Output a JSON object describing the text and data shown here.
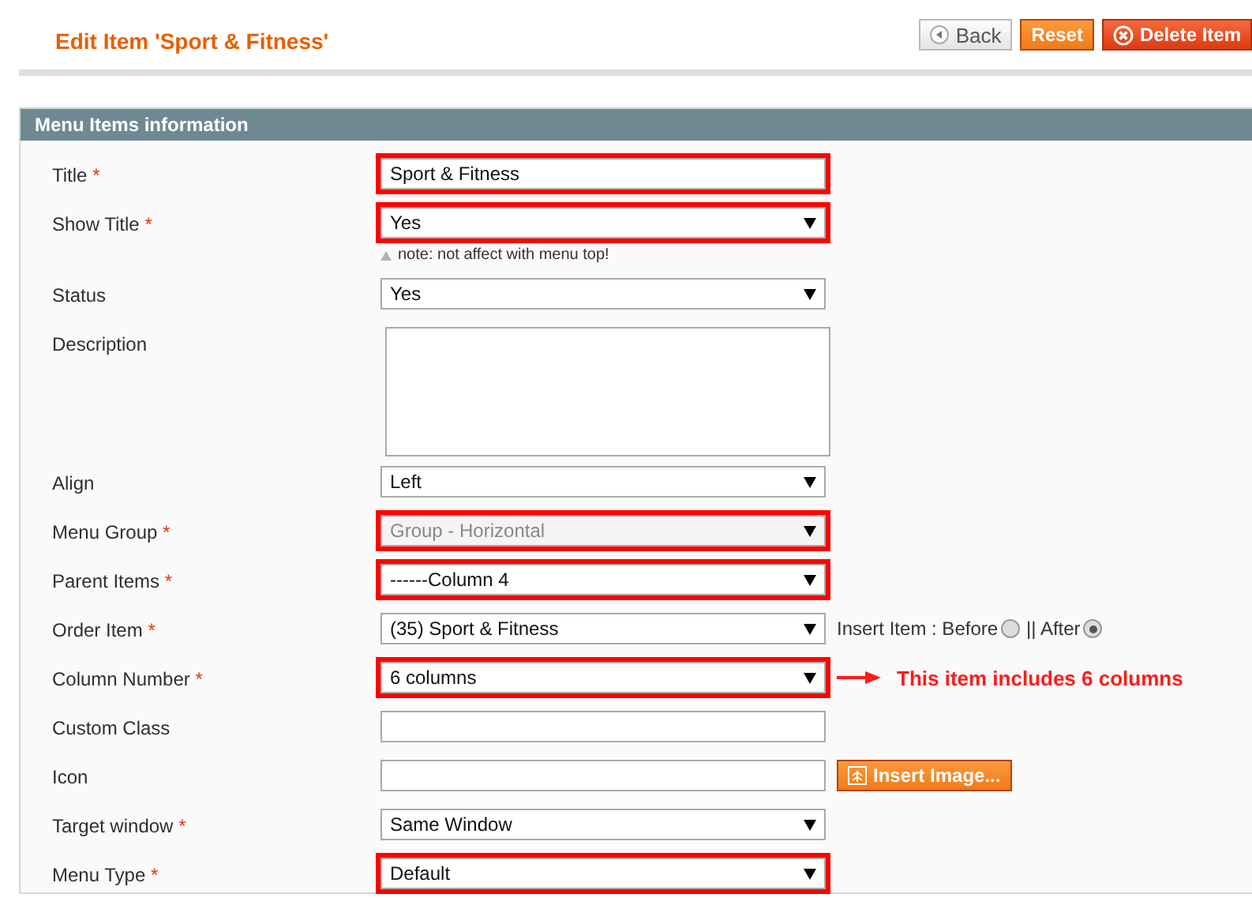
{
  "header": {
    "title": "Edit Item 'Sport & Fitness'",
    "buttons": [
      {
        "label": "Back",
        "kind": "back"
      },
      {
        "label": "Reset",
        "kind": "reset"
      },
      {
        "label": "Delete Item",
        "kind": "delete"
      }
    ]
  },
  "section": {
    "title": "Menu Items information"
  },
  "fields": [
    {
      "label": "Title",
      "required_mark": "*",
      "kind": "text",
      "value": "Sport & Fitness",
      "highlighted": true
    },
    {
      "label": "Show Title",
      "required_mark": "*",
      "kind": "select",
      "value": "Yes",
      "highlighted": true,
      "disabled": false,
      "note": "note: not affect with menu top!"
    },
    {
      "label": "Status",
      "kind": "select",
      "value": "Yes",
      "highlighted": false,
      "disabled": false
    },
    {
      "label": "Description",
      "kind": "textarea",
      "highlighted": false
    },
    {
      "label": "Align",
      "kind": "select",
      "value": "Left",
      "highlighted": false,
      "disabled": false
    },
    {
      "label": "Menu Group",
      "required_mark": "*",
      "kind": "select",
      "value": "Group - Horizontal",
      "highlighted": true,
      "disabled": true
    },
    {
      "label": "Parent Items",
      "required_mark": "*",
      "kind": "select",
      "value": "------Column 4",
      "highlighted": true,
      "disabled": false
    },
    {
      "label": "Order Item",
      "required_mark": "*",
      "kind": "select",
      "value": "(35) Sport & Fitness",
      "highlighted": false,
      "disabled": false,
      "options": [
        {
          "label": "Insert Item : Before",
          "selected": false
        },
        {
          "label": "|| After",
          "selected": true
        }
      ]
    },
    {
      "label": "Column Number",
      "required_mark": "*",
      "kind": "select",
      "value": "6 columns",
      "highlighted": true,
      "disabled": false,
      "annotation": "This item includes 6 columns"
    },
    {
      "label": "Custom Class",
      "kind": "text",
      "highlighted": false
    },
    {
      "label": "Icon",
      "kind": "text",
      "highlighted": false,
      "button": "Insert Image..."
    },
    {
      "label": "Target window",
      "required_mark": "*",
      "kind": "select",
      "value": "Same Window",
      "highlighted": false,
      "disabled": false
    },
    {
      "label": "Menu Type",
      "required_mark": "*",
      "kind": "select",
      "value": "Default",
      "highlighted": true,
      "disabled": false
    }
  ]
}
